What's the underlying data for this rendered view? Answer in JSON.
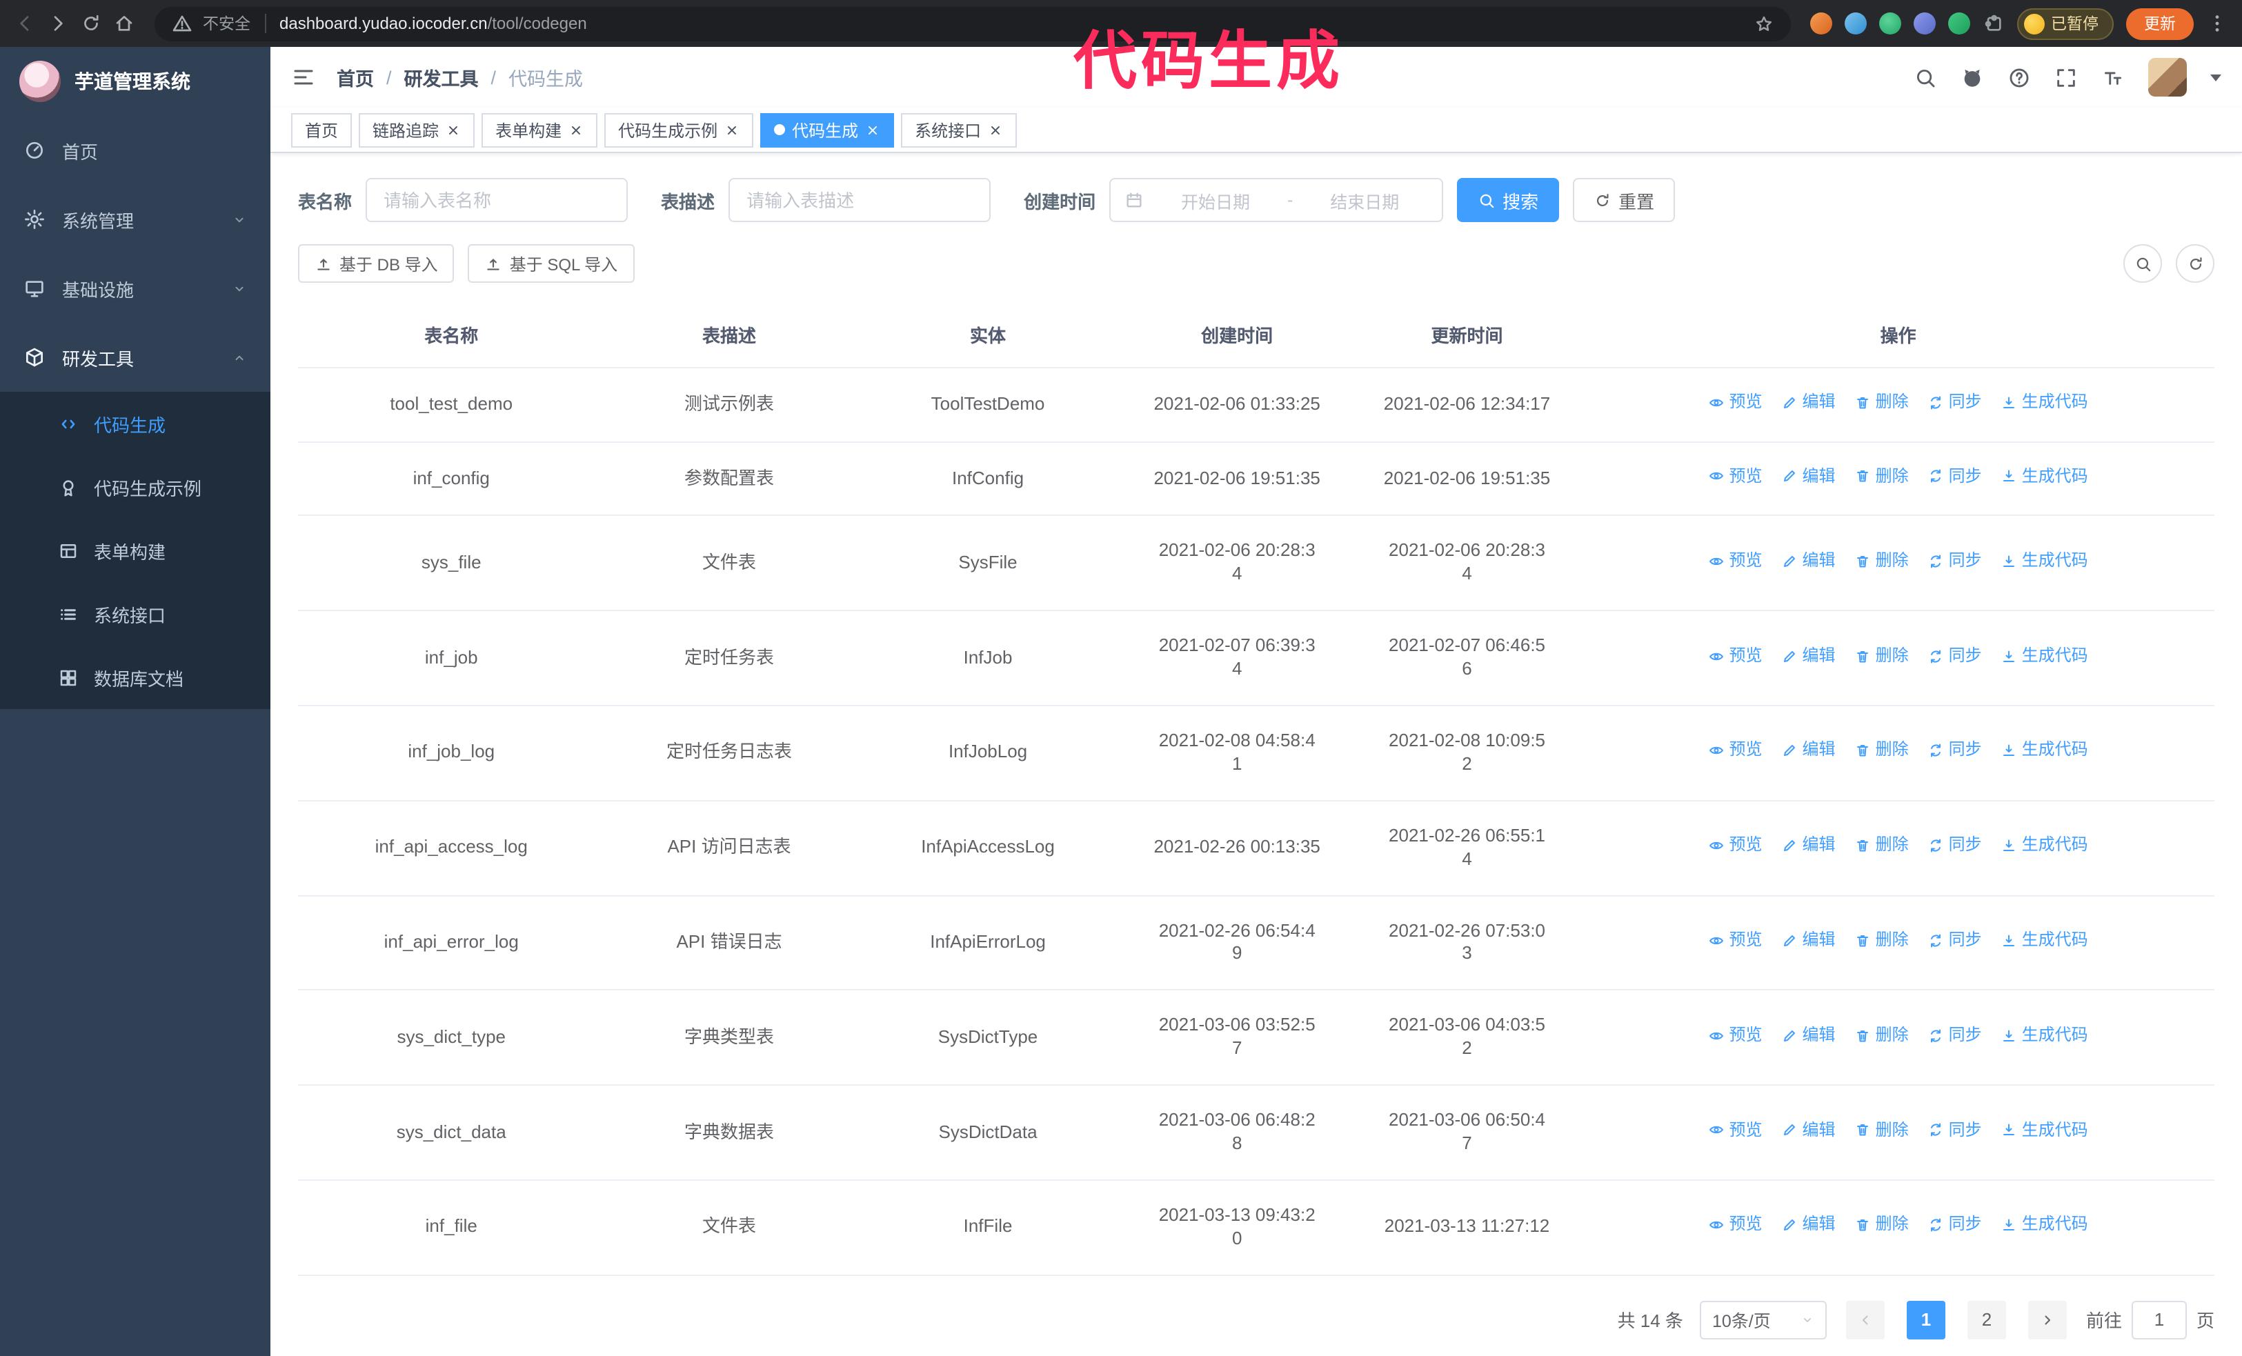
{
  "colors": {
    "accent": "#409eff",
    "annotation_pink": "#fb2b5b",
    "sidebar_bg": "#304156",
    "submenu_bg": "#1f2d3d",
    "update_button_orange": "#ec6c2d"
  },
  "browser": {
    "security_warning": "不安全",
    "url_host": "dashboard.yudao.iocoder.cn",
    "url_path": "/tool/codegen",
    "paused_badge": "已暂停",
    "update_button": "更新"
  },
  "annotation": {
    "title": "代码生成"
  },
  "sidebar": {
    "logo_title": "芋道管理系统",
    "items": [
      {
        "label": "首页"
      },
      {
        "label": "系统管理"
      },
      {
        "label": "基础设施"
      },
      {
        "label": "研发工具"
      }
    ],
    "submenu": [
      {
        "label": "代码生成",
        "active": true
      },
      {
        "label": "代码生成示例"
      },
      {
        "label": "表单构建"
      },
      {
        "label": "系统接口"
      },
      {
        "label": "数据库文档"
      }
    ]
  },
  "header": {
    "breadcrumb": [
      "首页",
      "研发工具",
      "代码生成"
    ],
    "separator": "/"
  },
  "tabs": [
    {
      "label": "首页"
    },
    {
      "label": "链路追踪"
    },
    {
      "label": "表单构建"
    },
    {
      "label": "代码生成示例"
    },
    {
      "label": "代码生成",
      "active": true
    },
    {
      "label": "系统接口"
    }
  ],
  "filters": {
    "table_name_label": "表名称",
    "table_name_placeholder": "请输入表名称",
    "table_desc_label": "表描述",
    "table_desc_placeholder": "请输入表描述",
    "create_time_label": "创建时间",
    "date_start_placeholder": "开始日期",
    "date_separator": "-",
    "date_end_placeholder": "结束日期",
    "search_button": "搜索",
    "reset_button": "重置"
  },
  "toolbar": {
    "import_db_button": "基于 DB 导入",
    "import_sql_button": "基于 SQL 导入"
  },
  "table": {
    "columns": [
      "表名称",
      "表描述",
      "实体",
      "创建时间",
      "更新时间",
      "操作"
    ],
    "actions": [
      "预览",
      "编辑",
      "删除",
      "同步",
      "生成代码"
    ],
    "rows": [
      {
        "name": "tool_test_demo",
        "desc": "测试示例表",
        "entity": "ToolTestDemo",
        "created": "2021-02-06 01:33:25",
        "updated": "2021-02-06 12:34:17"
      },
      {
        "name": "inf_config",
        "desc": "参数配置表",
        "entity": "InfConfig",
        "created": "2021-02-06 19:51:35",
        "updated": "2021-02-06 19:51:35"
      },
      {
        "name": "sys_file",
        "desc": "文件表",
        "entity": "SysFile",
        "created": "2021-02-06 20:28:3\n4",
        "updated": "2021-02-06 20:28:3\n4"
      },
      {
        "name": "inf_job",
        "desc": "定时任务表",
        "entity": "InfJob",
        "created": "2021-02-07 06:39:3\n4",
        "updated": "2021-02-07 06:46:5\n6"
      },
      {
        "name": "inf_job_log",
        "desc": "定时任务日志表",
        "entity": "InfJobLog",
        "created": "2021-02-08 04:58:4\n1",
        "updated": "2021-02-08 10:09:5\n2"
      },
      {
        "name": "inf_api_access_log",
        "desc": "API 访问日志表",
        "entity": "InfApiAccessLog",
        "created": "2021-02-26 00:13:35",
        "updated": "2021-02-26 06:55:1\n4"
      },
      {
        "name": "inf_api_error_log",
        "desc": "API 错误日志",
        "entity": "InfApiErrorLog",
        "created": "2021-02-26 06:54:4\n9",
        "updated": "2021-02-26 07:53:0\n3"
      },
      {
        "name": "sys_dict_type",
        "desc": "字典类型表",
        "entity": "SysDictType",
        "created": "2021-03-06 03:52:5\n7",
        "updated": "2021-03-06 04:03:5\n2"
      },
      {
        "name": "sys_dict_data",
        "desc": "字典数据表",
        "entity": "SysDictData",
        "created": "2021-03-06 06:48:2\n8",
        "updated": "2021-03-06 06:50:4\n7"
      },
      {
        "name": "inf_file",
        "desc": "文件表",
        "entity": "InfFile",
        "created": "2021-03-13 09:43:2\n0",
        "updated": "2021-03-13 11:27:12"
      }
    ]
  },
  "pagination": {
    "total": "共 14 条",
    "page_size": "10条/页",
    "pages": [
      "1",
      "2"
    ],
    "goto_label": "前往",
    "goto_value": "1",
    "page_unit": "页"
  }
}
